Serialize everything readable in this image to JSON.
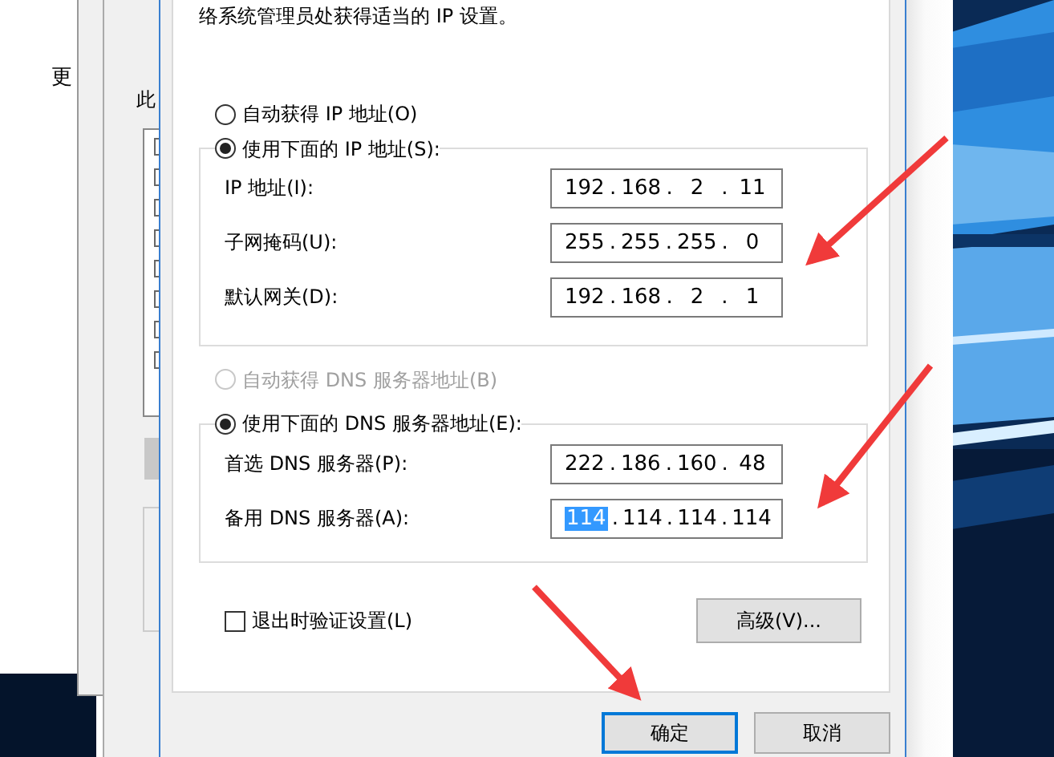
{
  "back_window": {
    "label": "更"
  },
  "back_dialog": {
    "label": "此"
  },
  "dialog": {
    "intro": "络系统管理员处获得适当的 IP 设置。",
    "dot": ".",
    "ip_auto": {
      "label": "自动获得 IP 地址(O)",
      "selected": false,
      "disabled": false
    },
    "ip_manual": {
      "label": "使用下面的 IP 地址(S):",
      "selected": true,
      "disabled": false
    },
    "ip_rows": [
      {
        "label": "IP 地址(I):",
        "octets": [
          {
            "text": "192",
            "selected": false
          },
          {
            "text": "168",
            "selected": false
          },
          {
            "text": "2",
            "selected": false
          },
          {
            "text": "11",
            "selected": false
          }
        ]
      },
      {
        "label": "子网掩码(U):",
        "octets": [
          {
            "text": "255",
            "selected": false
          },
          {
            "text": "255",
            "selected": false
          },
          {
            "text": "255",
            "selected": false
          },
          {
            "text": "0",
            "selected": false
          }
        ]
      },
      {
        "label": "默认网关(D):",
        "octets": [
          {
            "text": "192",
            "selected": false
          },
          {
            "text": "168",
            "selected": false
          },
          {
            "text": "2",
            "selected": false
          },
          {
            "text": "1",
            "selected": false
          }
        ]
      }
    ],
    "dns_auto": {
      "label": "自动获得 DNS 服务器地址(B)",
      "selected": false,
      "disabled": true
    },
    "dns_manual": {
      "label": "使用下面的 DNS 服务器地址(E):",
      "selected": true,
      "disabled": false
    },
    "dns_rows": [
      {
        "label": "首选 DNS 服务器(P):",
        "octets": [
          {
            "text": "222",
            "selected": false
          },
          {
            "text": "186",
            "selected": false
          },
          {
            "text": "160",
            "selected": false
          },
          {
            "text": "48",
            "selected": false
          }
        ]
      },
      {
        "label": "备用 DNS 服务器(A):",
        "octets": [
          {
            "text": "114",
            "selected": true
          },
          {
            "text": "114",
            "selected": false
          },
          {
            "text": "114",
            "selected": false
          },
          {
            "text": "114",
            "selected": false
          }
        ]
      }
    ],
    "validate": {
      "label": "退出时验证设置(L)",
      "checked": false
    },
    "advanced_button": "高级(V)...",
    "ok_button": {
      "label": "确定",
      "focused": true
    },
    "cancel_button": {
      "label": "取消",
      "focused": false
    }
  }
}
